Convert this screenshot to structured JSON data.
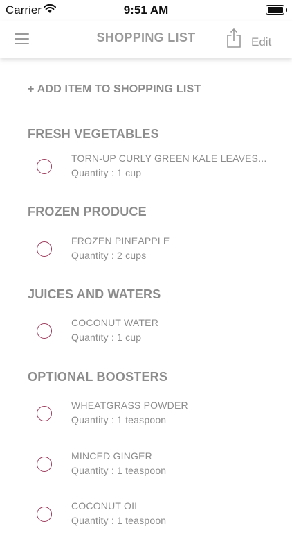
{
  "status_bar": {
    "carrier": "Carrier",
    "time": "9:51 AM"
  },
  "nav": {
    "title": "SHOPPING LIST",
    "edit_label": "Edit"
  },
  "add_item_label": "+ ADD ITEM TO SHOPPING LIST",
  "sections": [
    {
      "title": "FRESH VEGETABLES",
      "items": [
        {
          "name": "TORN-UP CURLY GREEN KALE LEAVES...",
          "quantity": "Quantity : 1 cup"
        }
      ]
    },
    {
      "title": "FROZEN PRODUCE",
      "items": [
        {
          "name": "FROZEN PINEAPPLE",
          "quantity": "Quantity : 2 cups"
        }
      ]
    },
    {
      "title": "JUICES AND WATERS",
      "items": [
        {
          "name": "COCONUT WATER",
          "quantity": "Quantity : 1 cup"
        }
      ]
    },
    {
      "title": "OPTIONAL BOOSTERS",
      "items": [
        {
          "name": "WHEATGRASS POWDER",
          "quantity": "Quantity : 1 teaspoon"
        },
        {
          "name": "MINCED GINGER",
          "quantity": "Quantity : 1 teaspoon"
        },
        {
          "name": "COCONUT OIL",
          "quantity": "Quantity : 1 teaspoon"
        }
      ]
    }
  ],
  "colors": {
    "accent": "#9c3a5c",
    "text": "#8c8c8c"
  }
}
